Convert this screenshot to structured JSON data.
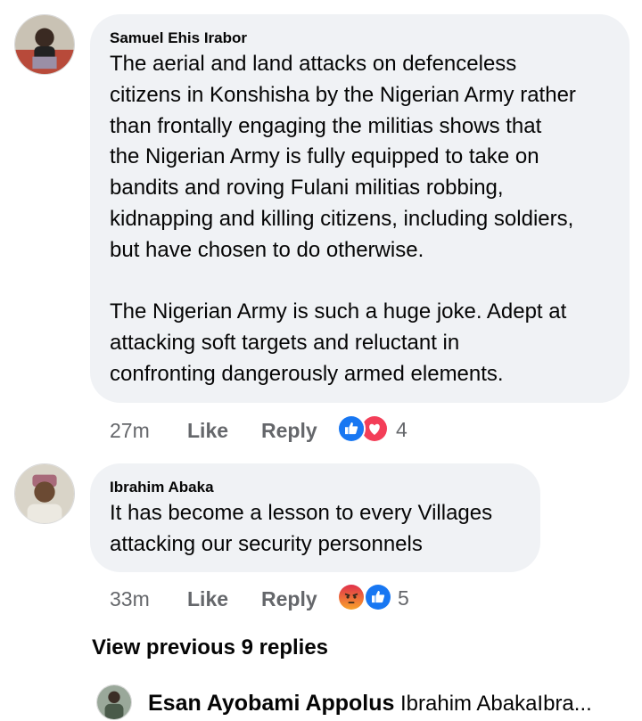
{
  "comments": [
    {
      "author": "Samuel Ehis Irabor",
      "text": "The aerial and land attacks on defenceless\ncitizens in Konshisha by the Nigerian Army rather\nthan frontally engaging the militias shows that\nthe Nigerian Army is fully equipped to take on\nbandits and roving Fulani militias robbing,\nkidnapping and killing citizens, including soldiers,\nbut have chosen to do otherwise.\n\nThe Nigerian Army is such a huge joke. Adept at\nattacking soft targets and reluctant in\nconfronting dangerously armed elements.",
      "time": "27m",
      "like_label": "Like",
      "reply_label": "Reply",
      "reactions": [
        "like-icon",
        "love-icon"
      ],
      "reaction_count": "4"
    },
    {
      "author": "Ibrahim Abaka",
      "text": "It has become a lesson to every Villages\nattacking our security personnels",
      "time": "33m",
      "like_label": "Like",
      "reply_label": "Reply",
      "reactions": [
        "angry-icon",
        "like-icon"
      ],
      "reaction_count": "5"
    }
  ],
  "view_previous": "View previous 9 replies",
  "reply_preview": {
    "author": "Esan Ayobami Appolus",
    "snippet": "Ibrahim AbakaIbra..."
  },
  "colors": {
    "bubble": "#f0f2f5",
    "secondary_text": "#65676b",
    "like_blue": "#1877f2",
    "love_red": "#f33e58",
    "angry_orange": "#e9710f"
  }
}
